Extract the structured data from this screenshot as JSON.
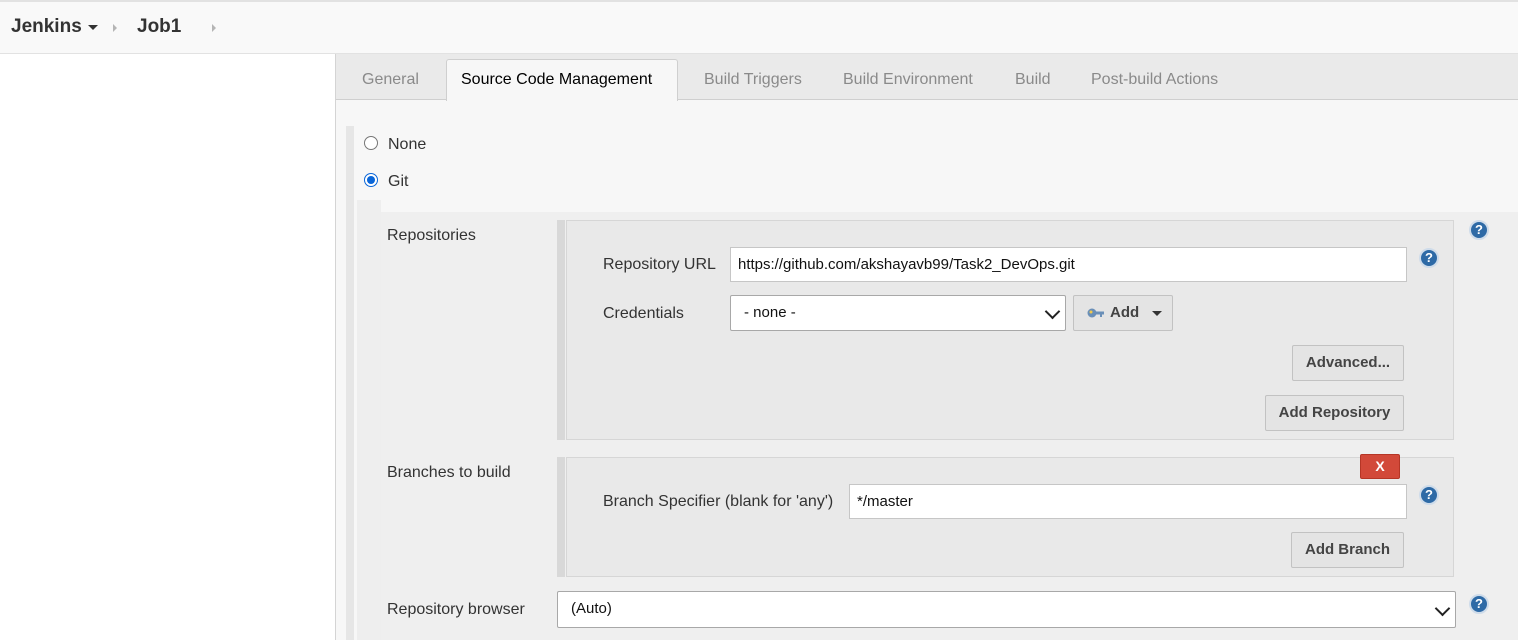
{
  "breadcrumb": {
    "root": "Jenkins",
    "job": "Job1"
  },
  "tabs": [
    {
      "label": "General"
    },
    {
      "label": "Source Code Management"
    },
    {
      "label": "Build Triggers"
    },
    {
      "label": "Build Environment"
    },
    {
      "label": "Build"
    },
    {
      "label": "Post-build Actions"
    }
  ],
  "scm": {
    "none_label": "None",
    "git_label": "Git",
    "selected": "Git"
  },
  "repositories": {
    "section_label": "Repositories",
    "url_label": "Repository URL",
    "url_value": "https://github.com/akshayavb99/Task2_DevOps.git",
    "credentials_label": "Credentials",
    "credentials_value": "- none -",
    "add_button": "Add",
    "advanced_button": "Advanced...",
    "add_repository_button": "Add Repository"
  },
  "branches": {
    "section_label": "Branches to build",
    "delete_button": "X",
    "specifier_label": "Branch Specifier (blank for 'any')",
    "specifier_value": "*/master",
    "add_branch_button": "Add Branch"
  },
  "repo_browser": {
    "label": "Repository browser",
    "value": "(Auto)"
  },
  "help_glyph": "?",
  "colors": {
    "help_icon": "#2e6aa6",
    "delete_button": "#d24939",
    "radio_selected": "#0a66d8"
  }
}
